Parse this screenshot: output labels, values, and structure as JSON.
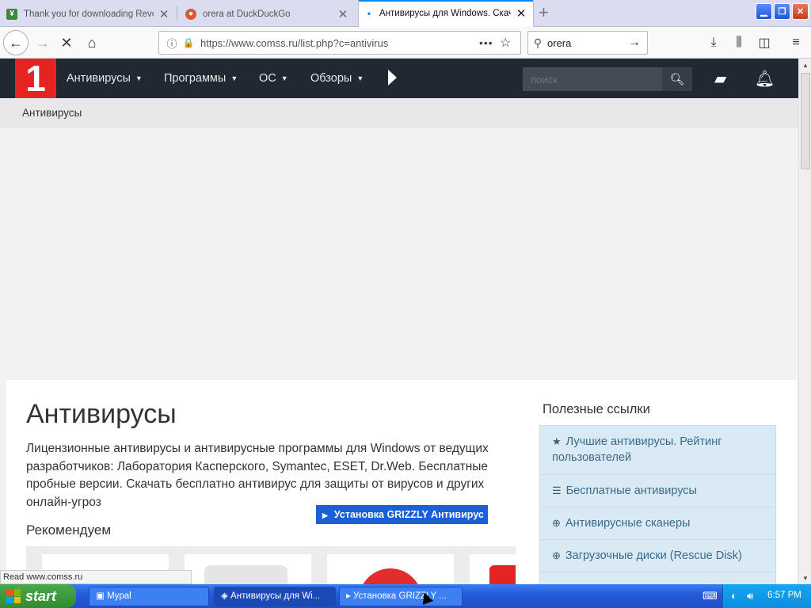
{
  "tabs": [
    {
      "title": "Thank you for downloading Revo",
      "icon": "revo-icon"
    },
    {
      "title": "orera at DuckDuckGo",
      "icon": "duckduckgo-icon"
    },
    {
      "title": "Антивирусы для Windows. Скача",
      "icon": "loading-icon"
    }
  ],
  "address_bar": {
    "url": "https://www.comss.ru/list.php?c=antivirus"
  },
  "browser_search": {
    "value": "orera"
  },
  "site_menu": [
    "Антивирусы",
    "Программы",
    "ОС",
    "Обзоры"
  ],
  "site_search": {
    "placeholder": "поиск"
  },
  "breadcrumb": "Антивирусы",
  "page": {
    "title": "Антивирусы",
    "desc_pre": "Лицензионные антивирусы и антивирусные программы для Windows от ведущих разработчиков: Лаборатория Касперского, Symantec, ESET, Dr.Web. Бесплатные пробные версии. Скачать бесплатно антивирус для защиты от вирусов и других онлайн-угроз",
    "recommend": "Рекомендуем",
    "promo": "Установка GRIZZLY Антивирус"
  },
  "useful": {
    "title": "Полезные ссылки",
    "items": [
      {
        "label": "Лучшие антивирусы. Рейтинг пользователей",
        "icon": "star-icon"
      },
      {
        "label": "Бесплатные антивирусы",
        "icon": "list-icon"
      },
      {
        "label": "Антивирусные сканеры",
        "icon": "zoom-icon"
      },
      {
        "label": "Загрузочные диски (Rescue Disk)",
        "icon": "plus-circle-icon"
      }
    ]
  },
  "status": "Read www.comss.ru",
  "taskbar": {
    "start": "start",
    "items": [
      "Mypal",
      "Антивирусы для Wi...",
      "Установка GRIZZLY ..."
    ],
    "clock": "6:57 PM"
  },
  "colors": {
    "brand_red": "#e52421",
    "header_bg": "#222831",
    "accent_blue": "#1a5fd6"
  }
}
